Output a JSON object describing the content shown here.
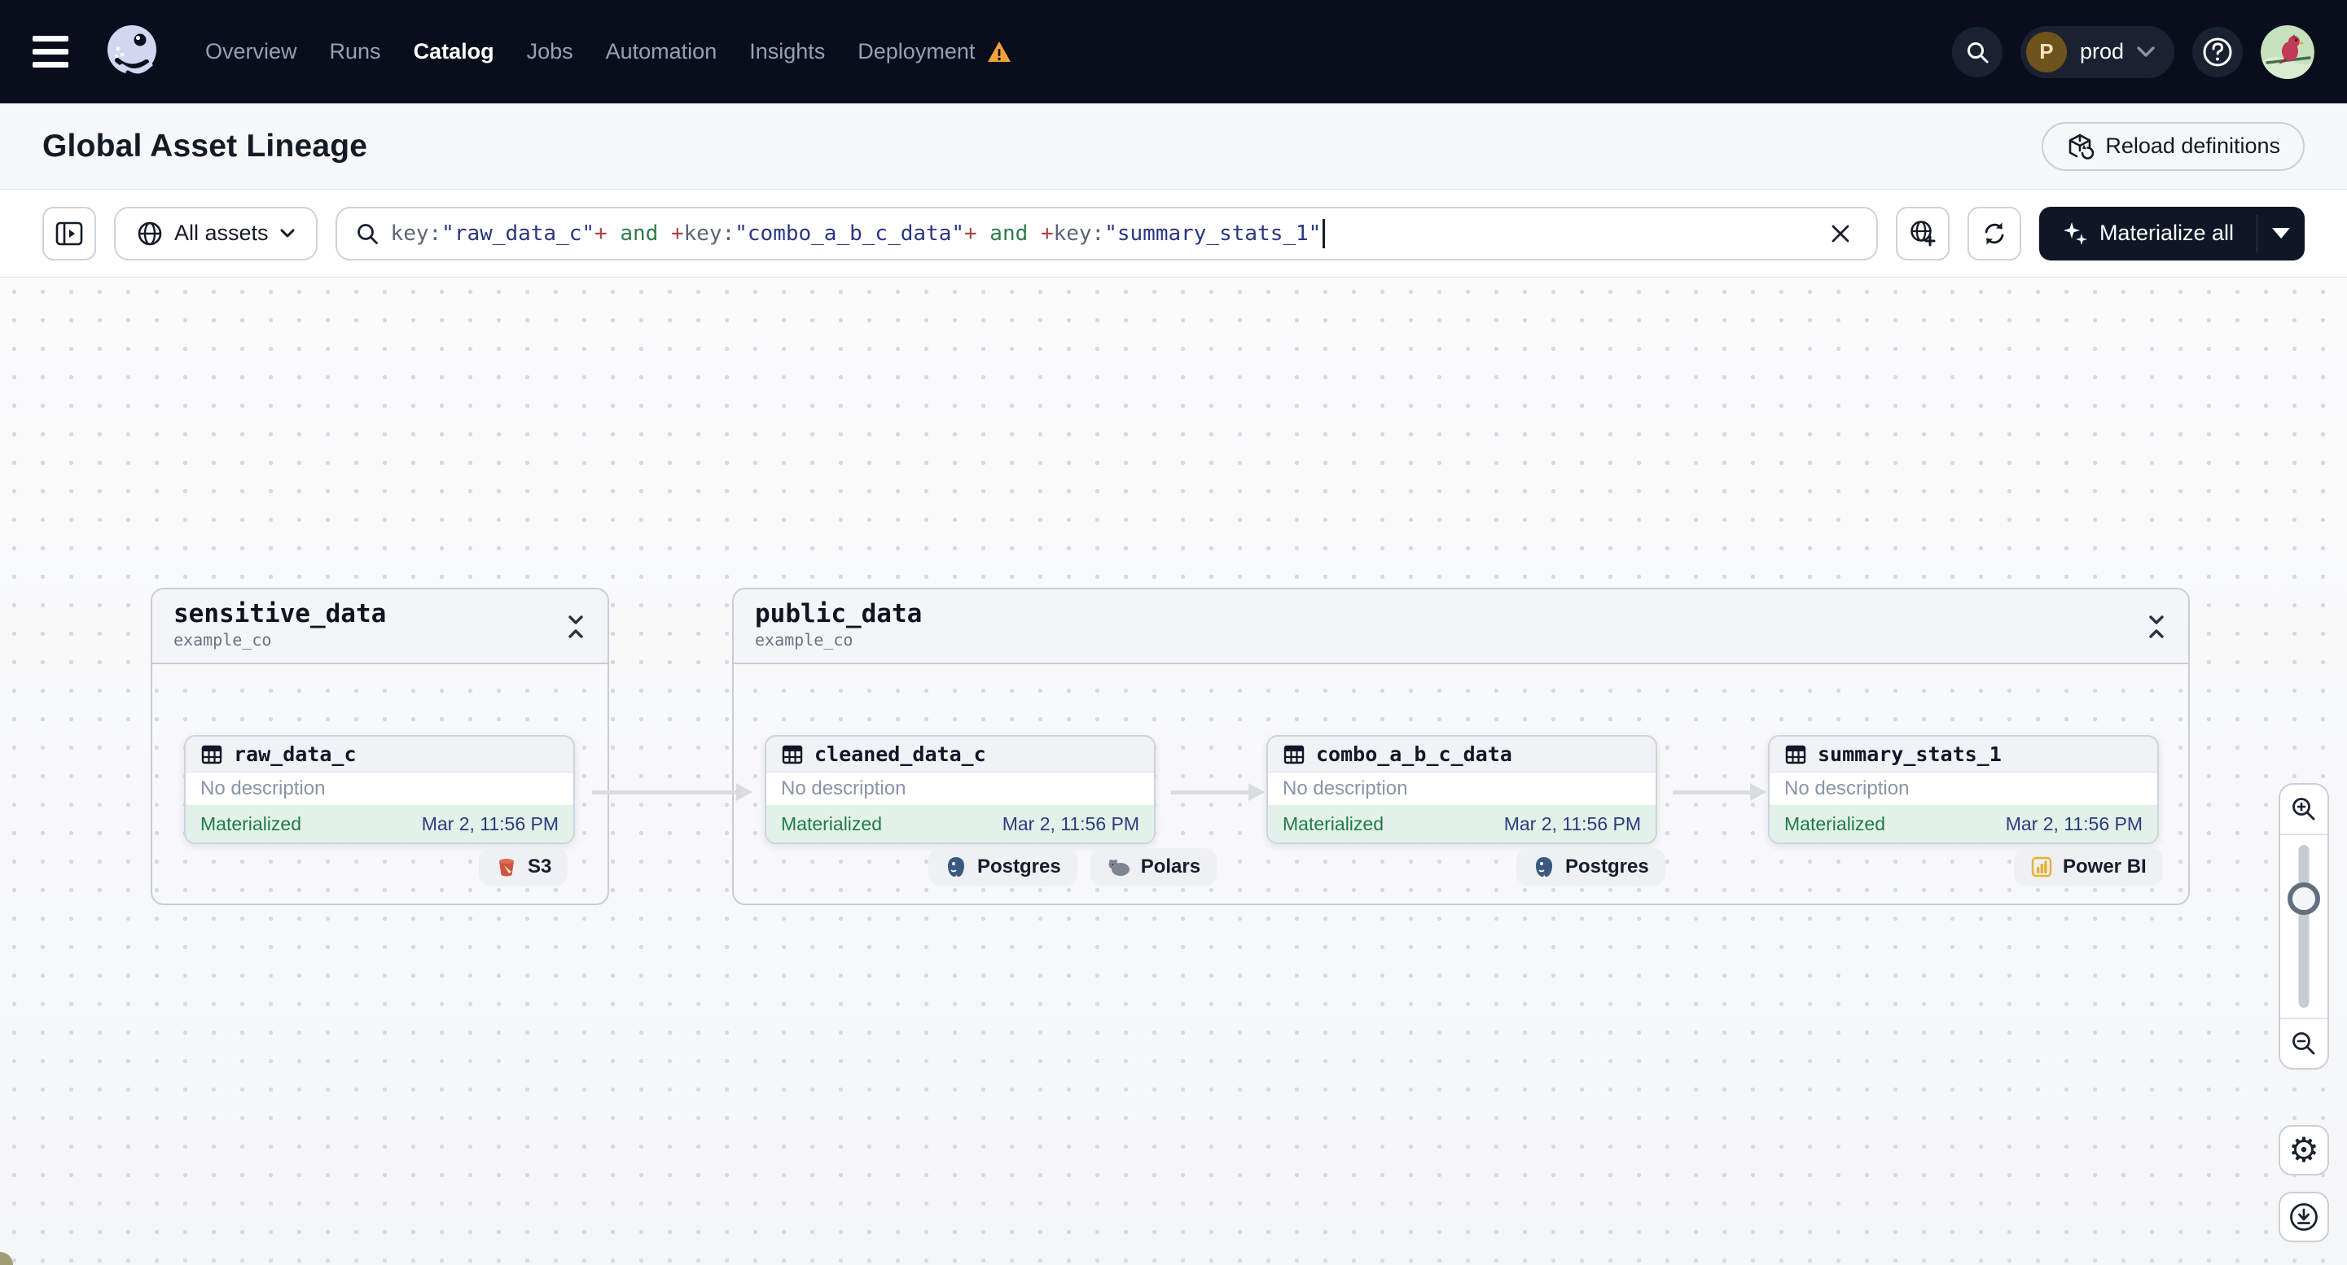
{
  "nav": {
    "items": [
      {
        "label": "Overview"
      },
      {
        "label": "Runs"
      },
      {
        "label": "Catalog"
      },
      {
        "label": "Jobs"
      },
      {
        "label": "Automation"
      },
      {
        "label": "Insights"
      },
      {
        "label": "Deployment"
      }
    ],
    "active_item": "Catalog",
    "deployment_warning": true,
    "workspace": {
      "initial": "P",
      "name": "prod"
    }
  },
  "header": {
    "title": "Global Asset Lineage",
    "reload_button": "Reload definitions"
  },
  "toolbar": {
    "scope_button": "All assets",
    "materialize_button": "Materialize all",
    "query_segments": [
      {
        "type": "field",
        "text": "key:"
      },
      {
        "type": "value",
        "text": "\"raw_data_c\""
      },
      {
        "type": "plus",
        "text": "+"
      },
      {
        "type": "keyword",
        "text": " and "
      },
      {
        "type": "plus",
        "text": "+"
      },
      {
        "type": "field",
        "text": "key:"
      },
      {
        "type": "value",
        "text": "\"combo_a_b_c_data\""
      },
      {
        "type": "plus",
        "text": "+"
      },
      {
        "type": "keyword",
        "text": " and "
      },
      {
        "type": "plus",
        "text": "+"
      },
      {
        "type": "field",
        "text": "key:"
      },
      {
        "type": "value",
        "text": "\"summary_stats_1\""
      }
    ]
  },
  "graph": {
    "groups": [
      {
        "name": "sensitive_data",
        "location": "example_co"
      },
      {
        "name": "public_data",
        "location": "example_co"
      }
    ],
    "nodes": [
      {
        "name": "raw_data_c",
        "description": "No description",
        "status": "Materialized",
        "timestamp": "Mar 2, 11:56 PM",
        "tags": [
          {
            "label": "S3"
          }
        ]
      },
      {
        "name": "cleaned_data_c",
        "description": "No description",
        "status": "Materialized",
        "timestamp": "Mar 2, 11:56 PM",
        "tags": [
          {
            "label": "Postgres"
          },
          {
            "label": "Polars"
          }
        ]
      },
      {
        "name": "combo_a_b_c_data",
        "description": "No description",
        "status": "Materialized",
        "timestamp": "Mar 2, 11:56 PM",
        "tags": [
          {
            "label": "Postgres"
          }
        ]
      },
      {
        "name": "summary_stats_1",
        "description": "No description",
        "status": "Materialized",
        "timestamp": "Mar 2, 11:56 PM",
        "tags": [
          {
            "label": "Power BI"
          }
        ]
      }
    ]
  },
  "colors": {
    "nav_bg": "#0A0E1C",
    "button_dark": "#0F1626",
    "materialized_green": "#20794A",
    "timestamp_blue": "#2C3A80",
    "warning_orange": "#F1A03C",
    "query_value": "#2B3780",
    "query_plus": "#A94442",
    "query_keyword": "#2E7D49"
  }
}
